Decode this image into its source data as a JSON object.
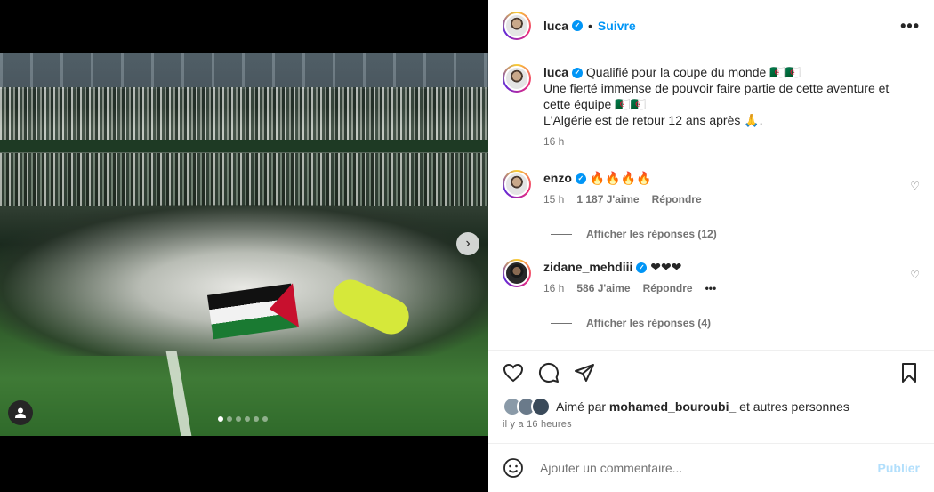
{
  "post": {
    "author": "luca",
    "follow_label": "Suivre",
    "separator": "•",
    "more_label": "•••"
  },
  "caption": {
    "author": "luca",
    "lines": [
      "Qualifié pour la coupe du monde 🇩🇿🇩🇿",
      "Une fierté immense de pouvoir faire partie de cette aventure et cette équipe 🇩🇿🇩🇿",
      "L'Algérie est de retour 12 ans après 🙏."
    ],
    "time": "16 h"
  },
  "comments": [
    {
      "author": "enzo",
      "text": "🔥🔥🔥🔥",
      "time": "15 h",
      "likes": "1 187 J'aime",
      "reply": "Répondre",
      "view_replies": "Afficher les réponses (12)"
    },
    {
      "author": "zidane_mehdiii",
      "text": "❤❤❤",
      "time": "16 h",
      "likes": "586 J'aime",
      "reply": "Répondre",
      "more": "•••",
      "view_replies": "Afficher les réponses (4)"
    }
  ],
  "likes_line": {
    "prefix": "Aimé par",
    "user": "mohamed_bouroubi_",
    "suffix": "et autres personnes"
  },
  "time_ago": "il y a 16 heures",
  "composer": {
    "placeholder": "Ajouter un commentaire...",
    "publish_label": "Publier"
  },
  "carousel": {
    "slides": 6,
    "active_index": 0
  },
  "colors": {
    "accent": "#0095f6",
    "publish_disabled": "#b2dffc",
    "muted_text": "#737373"
  }
}
